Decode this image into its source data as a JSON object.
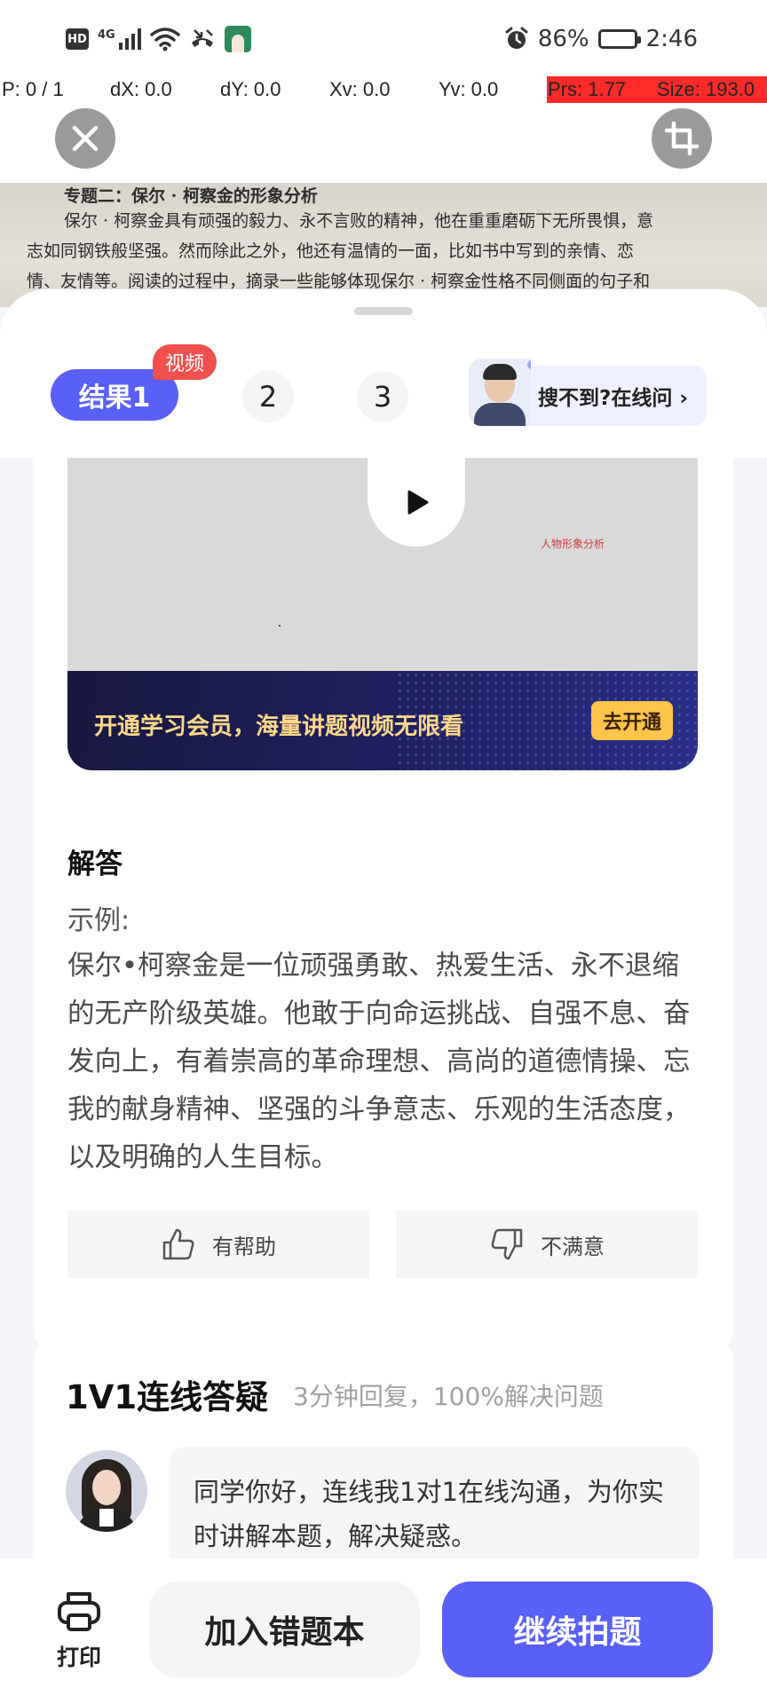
{
  "status_bar": {
    "hd": "HD",
    "network": "4G",
    "battery": "86%",
    "battery_level": 0.86,
    "time": "2:46",
    "icons": [
      "hd-icon",
      "signal-icon",
      "wifi-icon",
      "missed-call-icon",
      "app-notification-icon",
      "alarm-icon",
      "battery-icon"
    ]
  },
  "debug_overlay": {
    "pointer": "P: 0 / 1",
    "dx": "dX: 0.0",
    "dy": "dY: 0.0",
    "xv": "Xv: 0.0",
    "yv": "Yv: 0.0",
    "prs": "Prs: 1.77",
    "size": "Size: 193.0",
    "highlight_color": "#ff2a2a"
  },
  "top_controls": {
    "close_icon": "close-icon",
    "crop_icon": "crop-icon"
  },
  "photo": {
    "title": "专题二：保尔 · 柯察金的形象分析",
    "lines": [
      "保尔 · 柯察金具有顽强的毅力、永不言败的精神，他在重重磨砺下无所畏惧，意",
      "志如同钢铁般坚强。然而除此之外，他还有温情的一面，比如书中写到的亲情、恋",
      "情、友情等。阅读的过程中，摘录一些能够体现保尔 · 柯察金性格不同侧面的句子和"
    ]
  },
  "tabs": {
    "active": "结果1",
    "badge": "视频",
    "tab2": "2",
    "tab3": "3",
    "ask_online": "搜不到?在线问",
    "ask_chevron": "›"
  },
  "video": {
    "label": "人物形象分析",
    "promo_text": "开通学习会员，海量讲题视频无限看",
    "promo_button": "去开通"
  },
  "answer": {
    "title": "解答",
    "prefix": "示例:",
    "body": "保尔•柯察金是一位顽强勇敢、热爱生活、永不退缩的无产阶级英雄。他敢于向命运挑战、自强不息、奋发向上，有着崇高的革命理想、高尚的道德情操、忘我的献身精神、坚强的斗争意志、乐观的生活态度，以及明确的人生目标。",
    "helpful": "有帮助",
    "unsatisfied": "不满意"
  },
  "tutoring": {
    "title": "1V1连线答疑",
    "subtitle": "3分钟回复，100%解决问题",
    "message": "同学你好，连线我1对1在线沟通，为你实时讲解本题，解决疑惑。"
  },
  "bottom_bar": {
    "print": "打印",
    "add_wrong": "加入错题本",
    "continue": "继续拍题"
  },
  "colors": {
    "accent": "#5a5ff7",
    "badge_red": "#f0504e",
    "promo_gold": "#ffd88a"
  }
}
